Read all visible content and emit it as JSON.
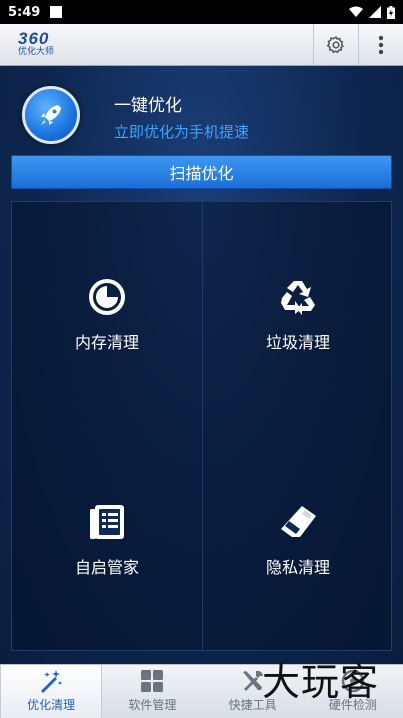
{
  "status_bar": {
    "time": "5:49"
  },
  "header": {
    "logo_number": "360",
    "logo_text": "优化大师",
    "settings_icon": "gear-icon",
    "menu_icon": "more-vertical-icon"
  },
  "hero": {
    "icon": "rocket-icon",
    "title": "一键优化",
    "subtitle": "立即优化为手机提速"
  },
  "scan_button": {
    "label": "扫描优化"
  },
  "tiles": [
    {
      "label": "内存清理",
      "icon": "memory-clean-icon"
    },
    {
      "label": "垃圾清理",
      "icon": "recycle-icon"
    },
    {
      "label": "自启管家",
      "icon": "list-icon"
    },
    {
      "label": "隐私清理",
      "icon": "eraser-icon"
    }
  ],
  "bottom_nav": [
    {
      "label": "优化清理",
      "icon": "magic-wand-icon",
      "active": true
    },
    {
      "label": "软件管理",
      "icon": "apps-grid-icon",
      "active": false
    },
    {
      "label": "快捷工具",
      "icon": "tools-icon",
      "active": false
    },
    {
      "label": "硬件检测",
      "icon": "hardware-check-icon",
      "active": false
    }
  ],
  "watermark": "大玩客",
  "colors": {
    "accent": "#3ea2ff",
    "scan_button": "#2a82e6",
    "active_nav": "#1e63c7"
  }
}
